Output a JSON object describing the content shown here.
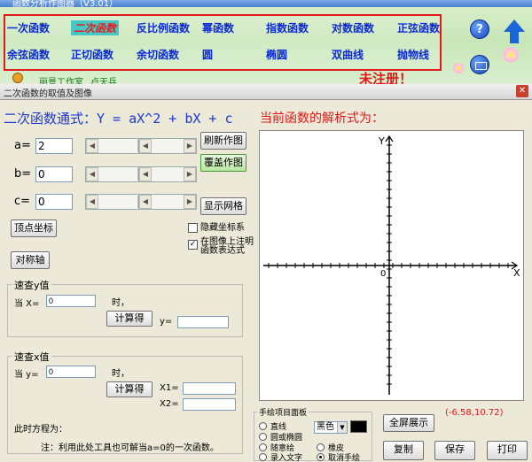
{
  "app": {
    "title": "函数分析作图器（V3.01）",
    "functions": [
      "一次函数",
      "二次函数",
      "反比例函数",
      "幂函数",
      "指数函数",
      "对数函数",
      "正弦函数",
      "余弦函数",
      "正切函数",
      "余切函数",
      "圆",
      "椭圆",
      "双曲线",
      "抛物线"
    ],
    "selected": "二次函数",
    "help": "?",
    "studio": "丽景工作室",
    "author": "卢天兵",
    "unregistered": "未注册！"
  },
  "window": {
    "title": "二次函数的取值及图像",
    "formula": "二次函数通式：Y = aX^2 + bX + c",
    "expr_title": "当前函数的解析式为："
  },
  "params": {
    "a_label": "a=",
    "a_value": "2",
    "b_label": "b=",
    "b_value": "0",
    "c_label": "c=",
    "c_value": "0"
  },
  "buttons": {
    "refresh": "刷新作图",
    "overlay": "覆盖作图",
    "grid": "显示网格",
    "vertex": "顶点坐标",
    "axis": "对称轴",
    "calc_y": "计算得",
    "calc_x": "计算得",
    "fullscreen": "全屏展示",
    "copy": "复制",
    "save": "保存",
    "print": "打印"
  },
  "options": {
    "hide_axes": "隐藏坐标系",
    "annotate_line1": "在图像上注明",
    "annotate_line2": "函数表达式",
    "hide_checked": false,
    "annotate_checked": true
  },
  "query_y": {
    "group": "速查y值",
    "when": "当 X=",
    "x_value": "0",
    "tail": "时，",
    "y_label": "y="
  },
  "query_x": {
    "group": "速查x值",
    "when": "当 y=",
    "y_value": "0",
    "tail": "时，",
    "x1": "X1=",
    "x2": "X2=",
    "equation": "此时方程为：",
    "note": "注：利用此处工具也可解当a=0的一次函数。"
  },
  "graph": {
    "y_axis": "Y",
    "x_axis": "X",
    "origin": "0"
  },
  "coords": "(-6.58,10.72)",
  "hand_panel": {
    "title": "手绘项目面板",
    "color": "黑色",
    "items": [
      {
        "label": "直线",
        "checked": false
      },
      {
        "label": "圆或椭圆",
        "checked": false
      },
      {
        "label": "随意绘",
        "checked": false
      },
      {
        "label": "橡皮",
        "checked": false
      },
      {
        "label": "录入文字",
        "checked": false
      },
      {
        "label": "取消手绘",
        "checked": true
      }
    ]
  },
  "colors": {
    "function_text": "#0a2ad8",
    "frame_red": "#e01818",
    "formula_blue": "#1a3ad8",
    "selected_bg": "#48c6c6"
  }
}
